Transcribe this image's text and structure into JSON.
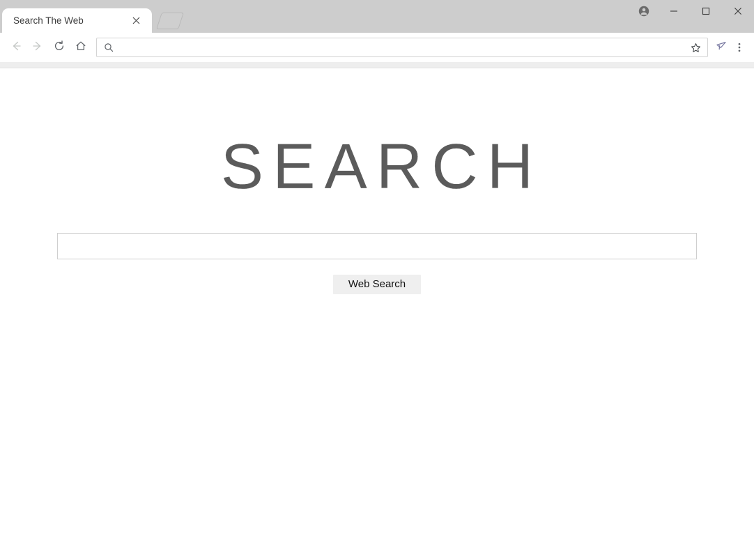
{
  "window": {
    "profile_icon": "account-circle-icon",
    "minimize_label": "–",
    "maximize_label": "□",
    "close_label": "✕"
  },
  "tabstrip": {
    "active_tab": {
      "title": "Search The Web",
      "close_icon": "close-icon"
    },
    "new_tab": {
      "icon": "new-tab-icon"
    }
  },
  "toolbar": {
    "back_icon": "arrow-left-icon",
    "forward_icon": "arrow-right-icon",
    "reload_icon": "reload-icon",
    "home_icon": "home-icon",
    "omnibox": {
      "search_icon": "search-icon",
      "value": "",
      "placeholder": "",
      "bookmark_icon": "star-icon"
    },
    "extension_icon": "extension-icon",
    "menu_icon": "three-dot-menu-icon"
  },
  "page": {
    "brand_title": "SEARCH",
    "search_field": {
      "value": "",
      "placeholder": ""
    },
    "submit_label": "Web Search"
  },
  "colors": {
    "titlebar": "#cdcdcd",
    "toolbar": "#ffffff",
    "page_bg": "#ffffff",
    "brand_text": "#5b5b5b",
    "button_bg": "#efefef",
    "border": "#cfcfcf",
    "extension_accent": "#7b7ba3"
  }
}
